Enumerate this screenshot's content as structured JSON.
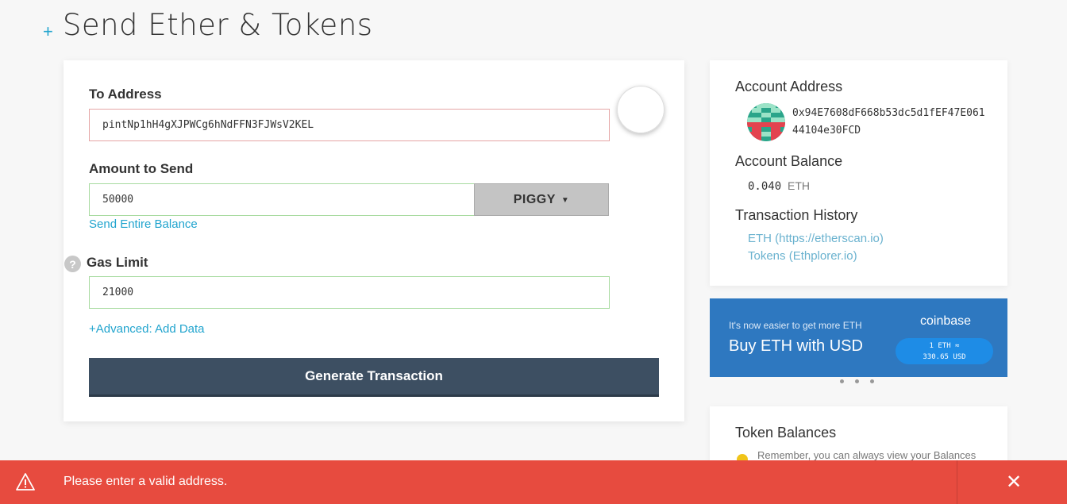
{
  "header": {
    "title": "Send Ether & Tokens",
    "plus_icon": "+"
  },
  "send_form": {
    "to_address": {
      "label": "To Address",
      "value": "pintNp1hH4gXJPWCg6hNdFFN3FJWsV2KEL"
    },
    "amount": {
      "label": "Amount to Send",
      "value": "50000",
      "token": "PIGGY",
      "send_entire_balance": "Send Entire Balance"
    },
    "gas_limit": {
      "label": "Gas Limit",
      "help_icon": "?",
      "value": "21000"
    },
    "advanced_link": "+Advanced: Add Data",
    "generate_button": "Generate Transaction"
  },
  "account": {
    "address_heading": "Account Address",
    "address": "0x94E7608dF668b53dc5d1fEF47E06144104e30FCD",
    "balance_heading": "Account Balance",
    "balance_value": "0.040",
    "balance_unit": "ETH",
    "history_heading": "Transaction History",
    "history_links": [
      "ETH (https://etherscan.io)",
      "Tokens (Ethplorer.io)"
    ]
  },
  "coinbase_banner": {
    "subtitle": "It's now easier to get more ETH",
    "title": "Buy ETH with USD",
    "brand": "coinbase",
    "rate_line1": "1 ETH ≈",
    "rate_line2": "330.65 USD"
  },
  "token_balances": {
    "heading": "Token Balances",
    "note": "Remember, you can always view your Balances"
  },
  "alert": {
    "message": "Please enter a valid address.",
    "close_glyph": "✕"
  },
  "colors": {
    "accent": "#21a4ce",
    "error": "#e74b3f",
    "button": "#3d4f62",
    "coinbase": "#2e78c0"
  },
  "icons": {
    "warning": "warning-triangle-icon",
    "close": "close-icon",
    "identicon": "identicon-avatar",
    "help": "question-circle-icon",
    "caret": "caret-down-icon"
  }
}
